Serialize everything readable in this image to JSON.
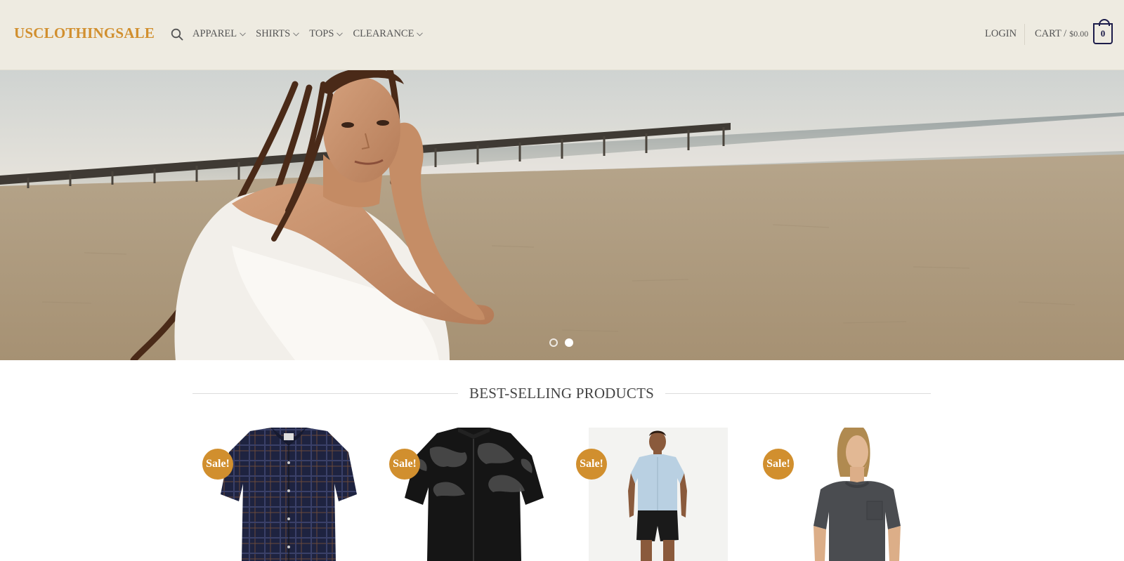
{
  "header": {
    "logo": "USCLOTHINGSALE",
    "nav": [
      {
        "label": "APPAREL"
      },
      {
        "label": "SHIRTS"
      },
      {
        "label": "TOPS"
      },
      {
        "label": "CLEARANCE"
      }
    ],
    "login_label": "LOGIN",
    "cart_label": "CART /",
    "cart_total": "$0.00",
    "cart_count": "0"
  },
  "hero": {
    "slide_count": 2,
    "active_slide": 2
  },
  "section": {
    "title": "BEST-SELLING PRODUCTS"
  },
  "products": [
    {
      "badge": "Sale!",
      "image": "navy-plaid-short-sleeve-shirt"
    },
    {
      "badge": "Sale!",
      "image": "black-camo-cycling-jersey"
    },
    {
      "badge": "Sale!",
      "image": "light-blue-short-sleeve-shirt-on-model"
    },
    {
      "badge": "Sale!",
      "image": "charcoal-pocket-tee-on-model"
    }
  ],
  "colors": {
    "accent": "#d18f2e",
    "header_bg": "#eeebe1",
    "cart_icon": "#1c1c4a"
  }
}
